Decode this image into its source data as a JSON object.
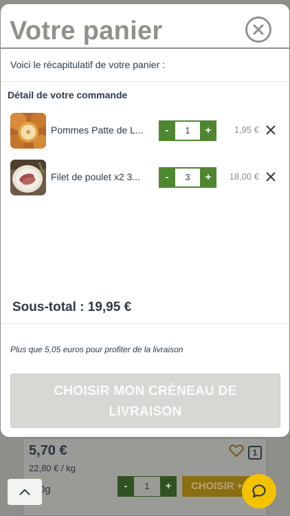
{
  "modal": {
    "title": "Votre panier",
    "intro": "Voici le récapitulatif de votre panier :",
    "section_title": "Détail de votre commande",
    "items": [
      {
        "name": "Pommes Patte de L...",
        "quantity": "1",
        "price": "1,95 €",
        "minus_label": "-",
        "plus_label": "+"
      },
      {
        "name": "Filet de poulet x2 3...",
        "quantity": "3",
        "price": "18,00 €",
        "minus_label": "-",
        "plus_label": "+"
      }
    ],
    "subtotal": "Sous-total : 19,95 €",
    "delivery_note": "Plus que 5,05 euros pour profiter de la livraison",
    "cta_label": "CHOISIR MON CRÉNEAU DE LIVRAISON"
  },
  "background": {
    "price": "5,70 €",
    "unit_price": "22,80 € / kg",
    "weight": "0g",
    "badge": "1",
    "quantity": "1",
    "minus_label": "-",
    "plus_label": "+",
    "choose_label": "CHOISIR +"
  },
  "colors": {
    "accent_green": "#4f8731",
    "title_grey": "#8f918b",
    "chat_yellow": "#f3c300",
    "cta_disabled": "#d7d8d4"
  }
}
